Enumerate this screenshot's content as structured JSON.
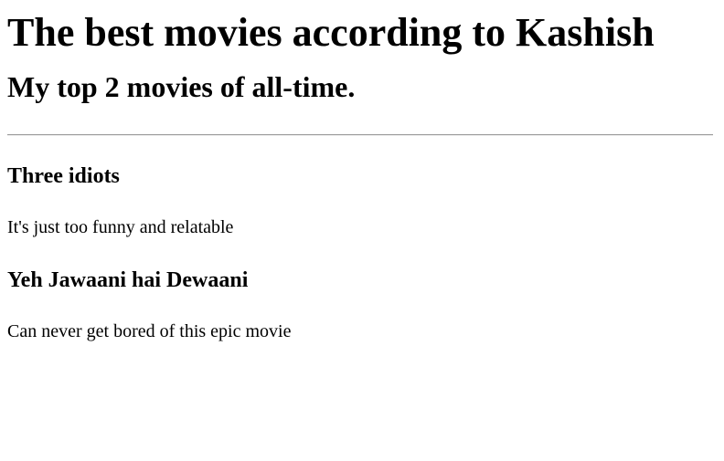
{
  "page": {
    "title": "The best movies according to Kashish",
    "subtitle": "My top 2 movies of all-time."
  },
  "movies": [
    {
      "title": "Three idiots",
      "description": "It's just too funny and relatable"
    },
    {
      "title": "Yeh Jawaani hai Dewaani",
      "description": "Can never get bored of this epic movie"
    }
  ]
}
